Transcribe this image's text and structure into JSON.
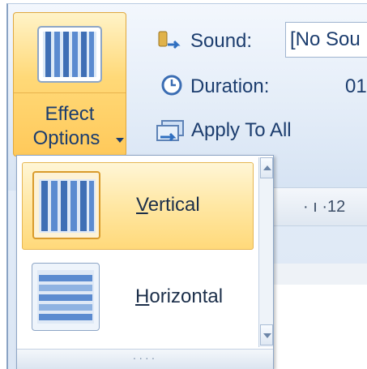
{
  "ribbon": {
    "effect_options": {
      "label_line1": "Effect",
      "label_line2": "Options",
      "icon": "vertical-bars-icon"
    },
    "sound": {
      "label": "Sound:",
      "value": "[No Sou",
      "icon": "sound-icon"
    },
    "duration": {
      "label": "Duration:",
      "value": "01",
      "icon": "clock-icon"
    },
    "apply_to_all": {
      "label": "Apply To All",
      "icon": "apply-to-all-icon"
    },
    "ruler_text": "· ı ·12"
  },
  "dropdown": {
    "items": [
      {
        "label": "Vertical",
        "selected": true,
        "icon": "vertical-bars-icon"
      },
      {
        "label": "Horizontal",
        "selected": false,
        "icon": "horizontal-bars-icon"
      }
    ],
    "grip": "····"
  },
  "colors": {
    "hover_gradient_top": "#fff6d6",
    "hover_gradient_bottom": "#ffd97a",
    "ribbon_text": "#1c3d6e",
    "border_blue": "#8ea6c6"
  }
}
